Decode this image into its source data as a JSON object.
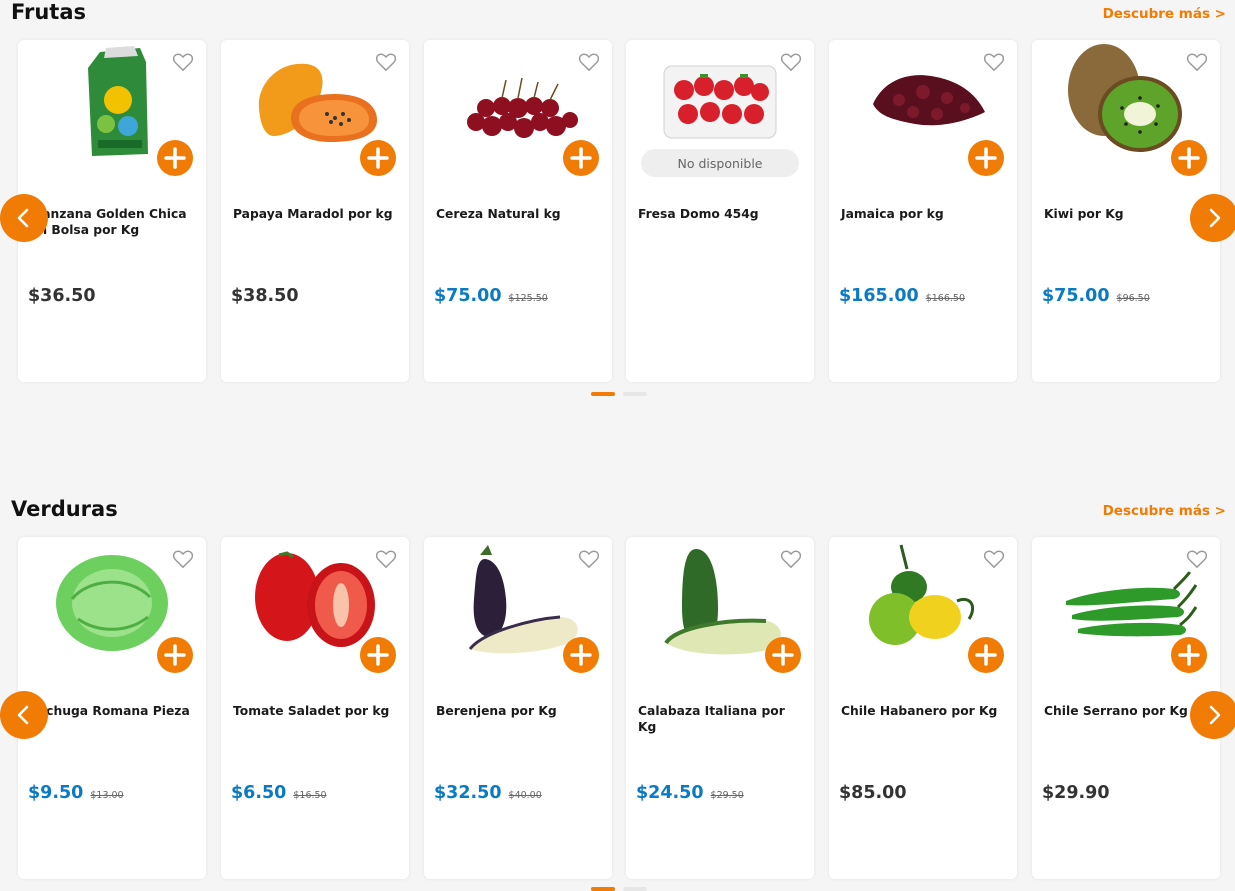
{
  "frutas": {
    "title": "Frutas",
    "more_label": "Descubre más >",
    "products": [
      {
        "name": "Manzana Golden Chica en Bolsa por Kg",
        "price": "$36.50",
        "old_price": "",
        "sale": false
      },
      {
        "name": "Papaya Maradol por kg",
        "price": "$38.50",
        "old_price": "",
        "sale": false
      },
      {
        "name": "Cereza Natural kg",
        "price": "$75.00",
        "old_price": "$125.50",
        "sale": true
      },
      {
        "name": "Fresa Domo 454g",
        "price": "",
        "old_price": "",
        "sale": false,
        "status": "No disponible"
      },
      {
        "name": "Jamaica por kg",
        "price": "$165.00",
        "old_price": "$166.50",
        "sale": true
      },
      {
        "name": "Kiwi por Kg",
        "price": "$75.00",
        "old_price": "$96.50",
        "sale": true
      }
    ]
  },
  "verduras": {
    "title": "Verduras",
    "more_label": "Descubre más >",
    "products": [
      {
        "name": "Lechuga Romana Pieza",
        "price": "$9.50",
        "old_price": "$13.00",
        "sale": true
      },
      {
        "name": "Tomate Saladet por kg",
        "price": "$6.50",
        "old_price": "$16.50",
        "sale": true
      },
      {
        "name": "Berenjena por Kg",
        "price": "$32.50",
        "old_price": "$40.00",
        "sale": true
      },
      {
        "name": "Calabaza Italiana por Kg",
        "price": "$24.50",
        "old_price": "$29.50",
        "sale": true
      },
      {
        "name": "Chile Habanero por Kg",
        "price": "$85.00",
        "old_price": "",
        "sale": false
      },
      {
        "name": "Chile Serrano por Kg",
        "price": "$29.90",
        "old_price": "",
        "sale": false
      }
    ]
  },
  "colors": {
    "accent": "#f07b05",
    "sale_price": "#0a7ac4",
    "regular_price": "#333333"
  },
  "carousel": {
    "pages": 2,
    "active_page": 1
  }
}
